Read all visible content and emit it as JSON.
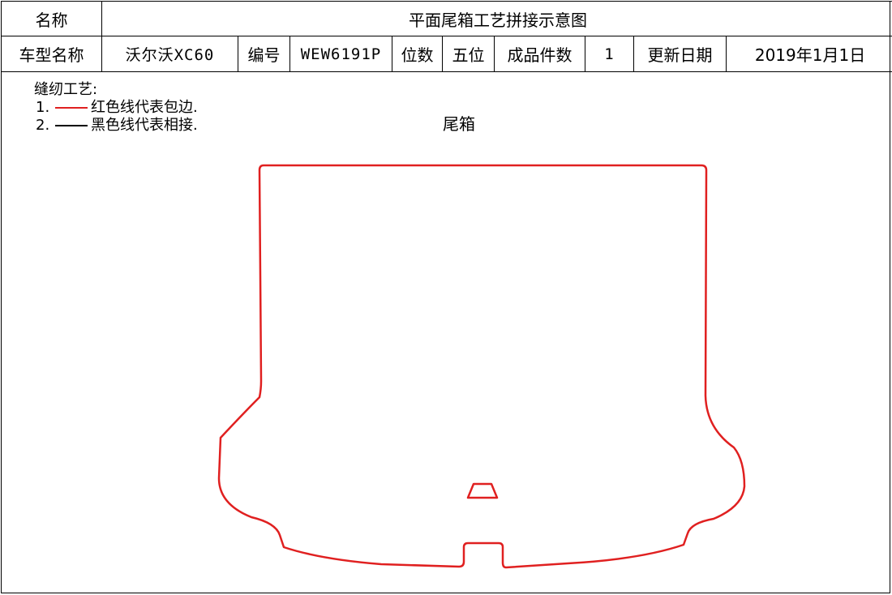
{
  "header": {
    "name_label": "名称",
    "drawing_title": "平面尾箱工艺拼接示意图",
    "model_label": "车型名称",
    "model_value": "沃尔沃XC60",
    "code_label": "编号",
    "code_value": "WEW6191P",
    "position_label": "位数",
    "position_value": "五位",
    "count_label": "成品件数",
    "count_value": "1",
    "date_label": "更新日期",
    "date_value": "2019年1月1日"
  },
  "legend": {
    "title": "缝纫工艺:",
    "items": [
      {
        "num": "1.",
        "text": "红色线代表包边.",
        "color": "#e02020"
      },
      {
        "num": "2.",
        "text": "黑色线代表相接.",
        "color": "#000000"
      }
    ]
  },
  "part": {
    "label": "尾箱",
    "outline_color": "#e02020"
  }
}
